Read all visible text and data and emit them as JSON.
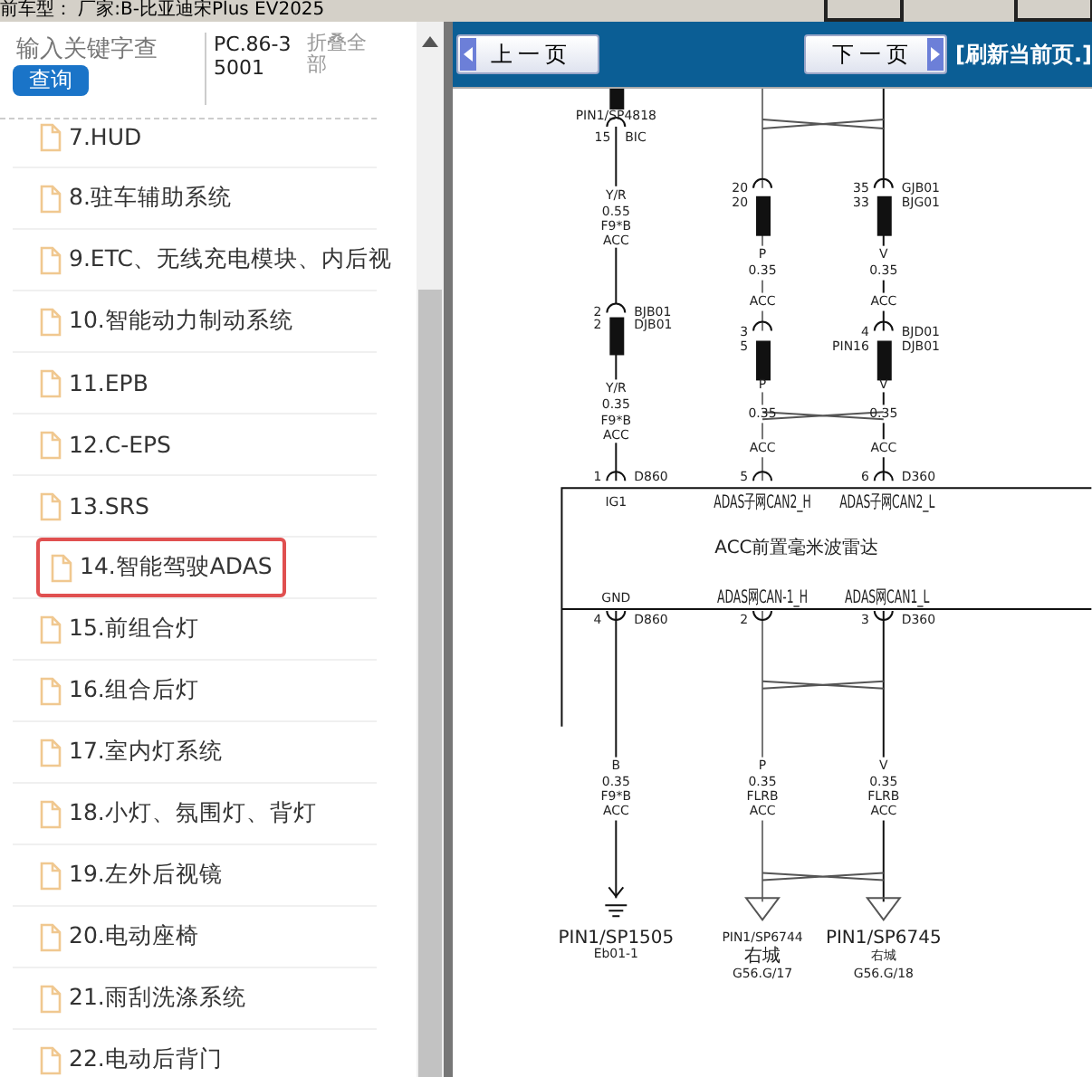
{
  "top_bar": {
    "vehicle": "前车型： 厂家:B-比亚迪宋Plus EV2025"
  },
  "sidebar": {
    "search": {
      "placeholder": "输入关键字查"
    },
    "search_button": "查询",
    "code": "PC.86-35001",
    "collapse_all": "折叠全部",
    "items": [
      {
        "label": "7.HUD",
        "selected": false
      },
      {
        "label": "8.驻车辅助系统",
        "selected": false
      },
      {
        "label": "9.ETC、无线充电模块、内后视",
        "selected": false
      },
      {
        "label": "10.智能动力制动系统",
        "selected": false
      },
      {
        "label": "11.EPB",
        "selected": false
      },
      {
        "label": "12.C-EPS",
        "selected": false
      },
      {
        "label": "13.SRS",
        "selected": false
      },
      {
        "label": "14.智能驾驶ADAS",
        "selected": true
      },
      {
        "label": "15.前组合灯",
        "selected": false
      },
      {
        "label": "16.组合后灯",
        "selected": false
      },
      {
        "label": "17.室内灯系统",
        "selected": false
      },
      {
        "label": "18.小灯、氛围灯、背灯",
        "selected": false
      },
      {
        "label": "19.左外后视镜",
        "selected": false
      },
      {
        "label": "20.电动座椅",
        "selected": false
      },
      {
        "label": "21.雨刮洗涤系统",
        "selected": false
      },
      {
        "label": "22.电动后背门",
        "selected": false
      }
    ]
  },
  "viewer": {
    "prev_button": "上一页",
    "next_button": "下一页",
    "refresh_link": "[刷新当前页.]",
    "diagram": {
      "module": "ACC前置毫米波雷达",
      "columns": [
        {
          "upper": [
            "PIN1/SP4818",
            "15",
            "BIC",
            "Y/R",
            "0.55",
            "F9*B",
            "ACC",
            "2",
            "2",
            "BJB01",
            "DJB01",
            "Y/R",
            "0.35",
            "F9*B",
            "ACC",
            "1",
            "D860",
            "IG1"
          ],
          "lower": [
            "GND",
            "4",
            "D860",
            "B",
            "0.35",
            "F9*B",
            "ACC",
            "PIN1/SP1505",
            "Eb01-1"
          ]
        },
        {
          "upper": [
            "20",
            "20",
            "P",
            "0.35",
            "ACC",
            "3",
            "5",
            "P",
            "0.35",
            "ACC",
            "5",
            "ADAS子网CAN2_H"
          ],
          "lower": [
            "ADAS网CAN-1_H",
            "2",
            "P",
            "0.35",
            "FLRB",
            "ACC",
            "PIN1/SP6744",
            "右城",
            "G56.G/17"
          ]
        },
        {
          "upper": [
            "35",
            "33",
            "GJB01",
            "BJG01",
            "V",
            "0.35",
            "ACC",
            "4",
            "PIN16",
            "BJD01",
            "DJB01",
            "V",
            "0.35",
            "ACC",
            "6",
            "D360",
            "ADAS子网CAN2_L"
          ],
          "lower": [
            "ADAS网CAN1_L",
            "3",
            "D360",
            "V",
            "0.35",
            "FLRB",
            "ACC",
            "PIN1/SP6745",
            "右城",
            "G56.G/18"
          ]
        }
      ]
    }
  }
}
